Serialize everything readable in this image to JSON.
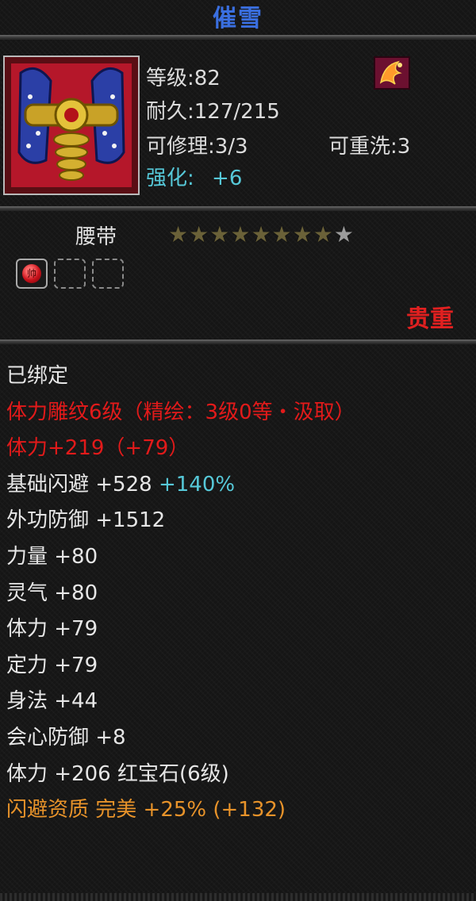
{
  "title": "催雪",
  "stats": {
    "level": "等级:82",
    "durability": "耐久:127/215",
    "repairable": "可修理:3/3",
    "rewash": "可重洗:3",
    "enhance_label": "强化:",
    "enhance_value": "+6"
  },
  "item_type": "腰带",
  "stars": {
    "lit": 8,
    "total": 9
  },
  "gem_slots": {
    "filled": 1,
    "total": 3,
    "gem_glyph": "帅"
  },
  "quality": "贵重",
  "lines": [
    {
      "text": "已绑定",
      "color": "white"
    },
    {
      "text": "体力雕纹6级（精绘：3级0等・汲取）",
      "color": "red"
    },
    {
      "text": "体力+219（+79）",
      "color": "red"
    },
    {
      "text": "基础闪避 +528 ",
      "extra": "+140%",
      "color": "white"
    },
    {
      "text": "外功防御 +1512",
      "color": "white"
    },
    {
      "text": "力量 +80",
      "color": "white"
    },
    {
      "text": "灵气 +80",
      "color": "white"
    },
    {
      "text": "体力 +79",
      "color": "white"
    },
    {
      "text": "定力 +79",
      "color": "white"
    },
    {
      "text": "身法 +44",
      "color": "white"
    },
    {
      "text": "会心防御 +8",
      "color": "white"
    },
    {
      "text": "体力 +206 红宝石(6级)",
      "color": "white"
    },
    {
      "text": "闪避资质 完美 +25% (+132)",
      "color": "orange"
    }
  ],
  "colors": {
    "title": "#3a6fe0",
    "red": "#e21a1a",
    "cyan": "#56c8d8",
    "orange": "#e8932a"
  },
  "icons": {
    "portrait": "belt-item-icon",
    "top_right": "phoenix-badge-icon"
  }
}
